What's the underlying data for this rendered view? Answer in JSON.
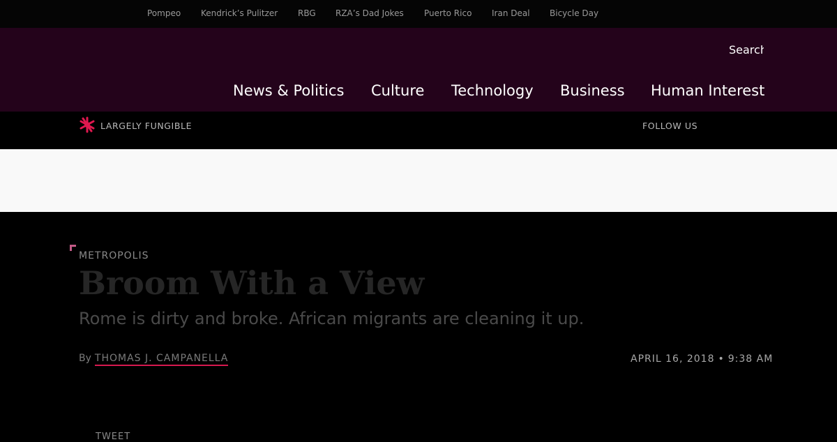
{
  "trending": {
    "items": [
      {
        "label": "Pompeo"
      },
      {
        "label": "Kendrick’s Pulitzer"
      },
      {
        "label": "RBG"
      },
      {
        "label": "RZA’s Dad Jokes"
      },
      {
        "label": "Puerto Rico"
      },
      {
        "label": "Iran Deal"
      },
      {
        "label": "Bicycle Day"
      }
    ]
  },
  "masthead": {
    "search_placeholder": "Search",
    "nav": [
      {
        "label": "News & Politics"
      },
      {
        "label": "Culture"
      },
      {
        "label": "Technology"
      },
      {
        "label": "Business"
      },
      {
        "label": "Human Interest"
      }
    ]
  },
  "subheader": {
    "brand": "LARGELY FUNGIBLE",
    "follow": "FOLLOW US"
  },
  "article": {
    "kicker": "METROPOLIS",
    "headline": "Broom With a View",
    "dek": "Rome is dirty and broke. African migrants are cleaning it up.",
    "byline_prefix": "By",
    "author": "THOMAS J. CAMPANELLA",
    "date": "APRIL 16, 2018",
    "separator": "•",
    "time": "9:38 AM",
    "share_label": "TWEET"
  },
  "colors": {
    "masthead_bg": "#24031b",
    "accent": "#d6194f",
    "page_bg": "#000000",
    "ad_bg": "#f9f9f9"
  }
}
